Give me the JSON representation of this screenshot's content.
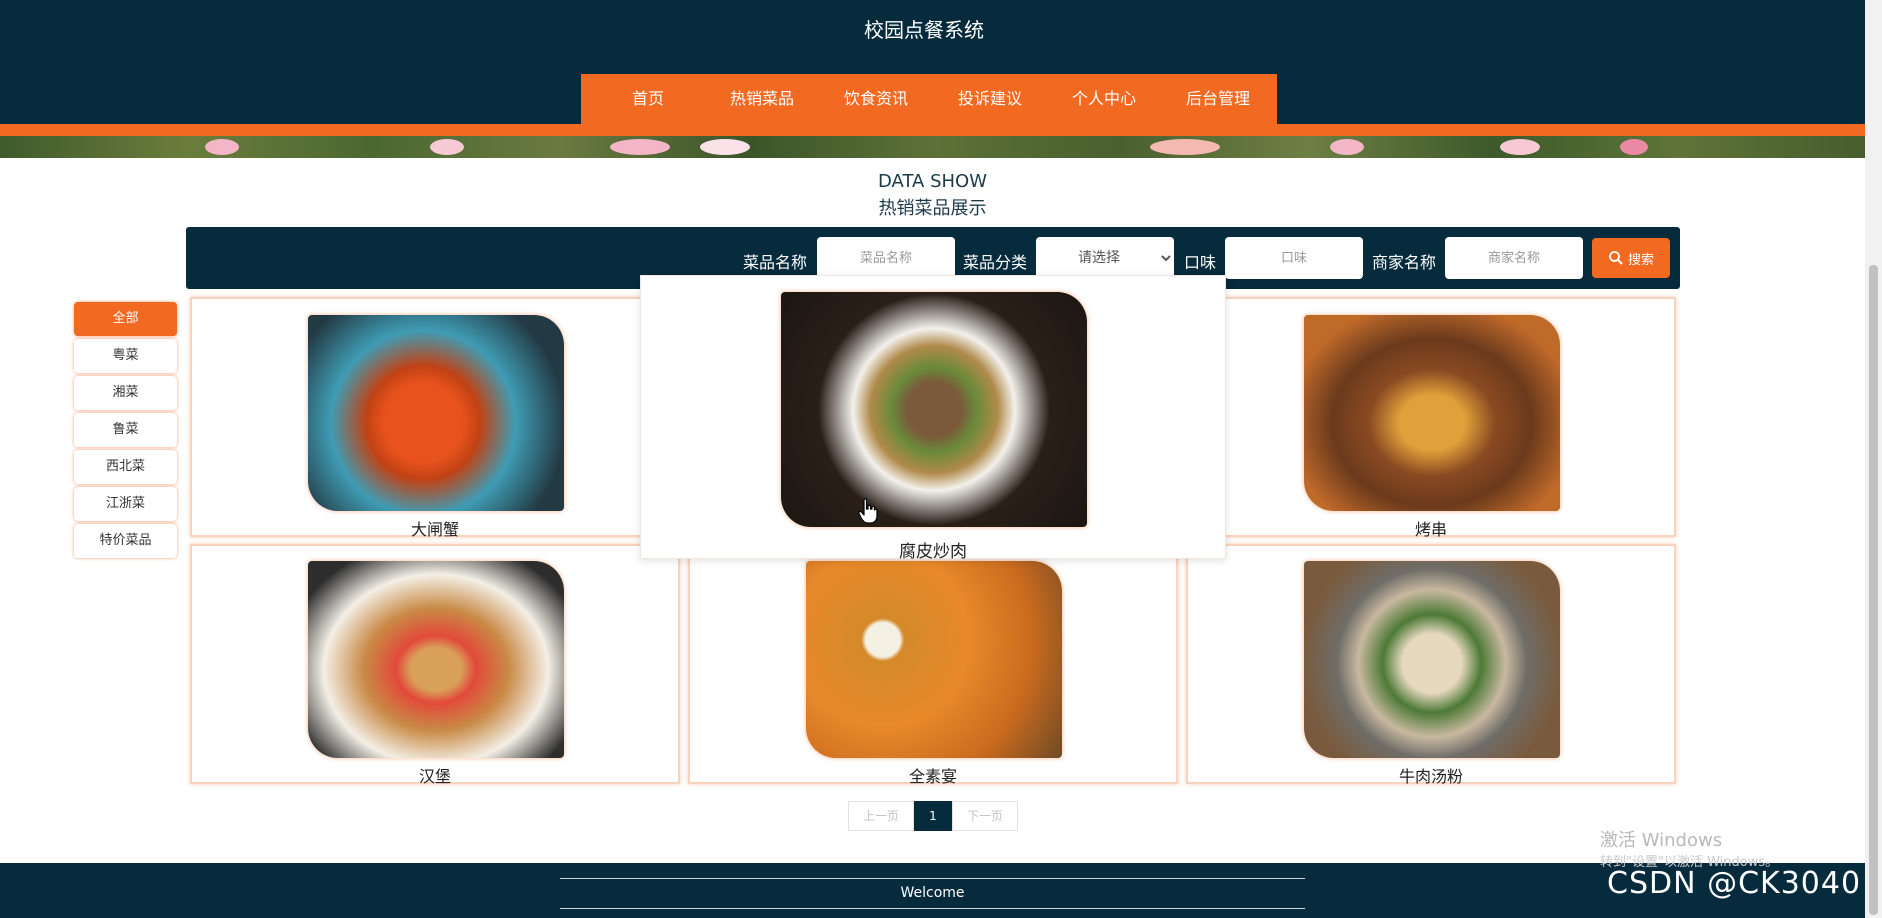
{
  "header": {
    "site_title": "校园点餐系统",
    "nav": [
      "首页",
      "热销菜品",
      "饮食资讯",
      "投诉建议",
      "个人中心",
      "后台管理"
    ]
  },
  "section": {
    "title_en": "DATA SHOW",
    "title_cn": "热销菜品展示"
  },
  "search": {
    "name_label": "菜品名称",
    "name_placeholder": "菜品名称",
    "category_label": "菜品分类",
    "category_selected": "请选择",
    "taste_label": "口味",
    "taste_placeholder": "口味",
    "merchant_label": "商家名称",
    "merchant_placeholder": "商家名称",
    "button_label": "搜索",
    "button_icon": "search-icon"
  },
  "categories": [
    "全部",
    "粤菜",
    "湘菜",
    "鲁菜",
    "西北菜",
    "江浙菜",
    "特价菜品"
  ],
  "active_category": "全部",
  "products": [
    "大闸蟹",
    "腐皮炒肉",
    "烤串",
    "汉堡",
    "全素宴",
    "牛肉汤粉"
  ],
  "hovered_product": "腐皮炒肉",
  "pager": {
    "prev": "上一页",
    "current": "1",
    "next": "下一页"
  },
  "footer": {
    "text": "Welcome"
  },
  "watermarks": {
    "windows_line1": "激活 Windows",
    "windows_line2": "转到\"设置\"以激活 Windows。",
    "csdn": "CSDN @CK3040"
  },
  "colors": {
    "navy": "#062b3d",
    "orange": "#f26a22"
  }
}
